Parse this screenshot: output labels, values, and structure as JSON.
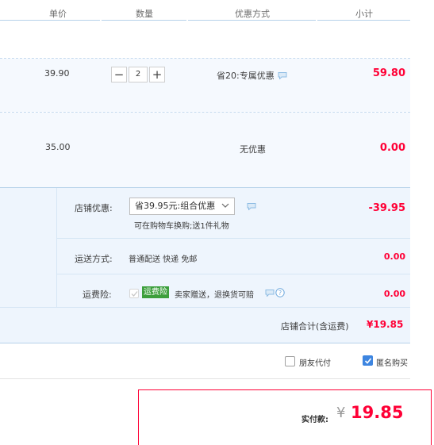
{
  "header": {
    "columns": [
      "单价",
      "数量",
      "优惠方式",
      "小计"
    ]
  },
  "items": [
    {
      "price": "39.90",
      "quantity": "2",
      "promo": "省20:专属优惠",
      "subtotal": "59.80"
    },
    {
      "price": "35.00",
      "promo": "无优惠",
      "subtotal": "0.00"
    }
  ],
  "shop": {
    "discount_label": "店铺优惠:",
    "discount_option": "省39.95元:组合优惠",
    "discount_note": "可在购物车换购;送1件礼物",
    "discount_amount": "-39.95",
    "shipping_label": "运送方式:",
    "shipping_value": "普通配送 快递 免邮",
    "shipping_amount": "0.00",
    "insurance_label": "运费险:",
    "insurance_tag": "运费险",
    "insurance_text": "卖家赠送，退换货可赔",
    "insurance_amount": "0.00",
    "total_label": "店铺合计(含运费)",
    "total_amount": "¥19.85"
  },
  "options": {
    "friend_pay_label": "朋友代付",
    "anonymous_label": "匿名购买"
  },
  "payment": {
    "label": "实付款:",
    "currency": "¥",
    "amount": "19.85"
  },
  "colors": {
    "accent_red": "#ff0036",
    "row_bg": "#f5f9fe",
    "checkbox_blue": "#3d85e0",
    "insurance_green": "#3c9f3c"
  },
  "icons": {
    "chat": "chat-icon",
    "help": "help-icon",
    "minus": "minus-icon",
    "plus": "plus-icon",
    "chevron": "chevron-down-icon"
  }
}
